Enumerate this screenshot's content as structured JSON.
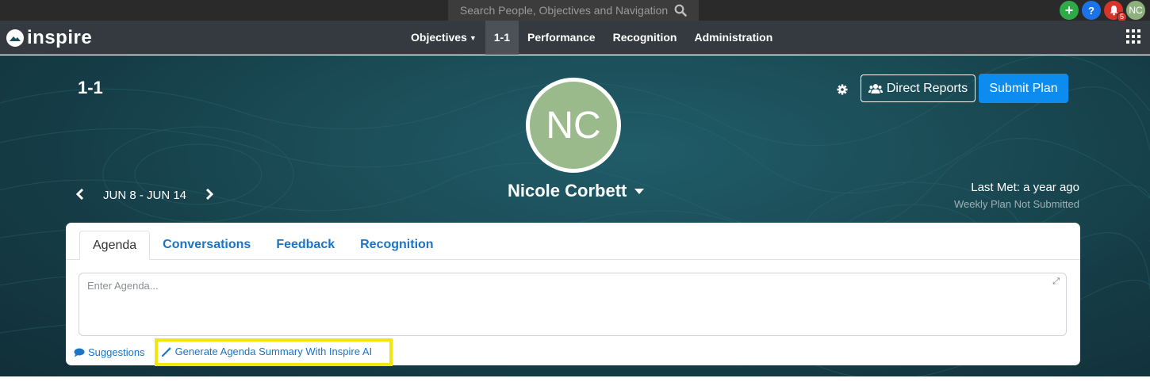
{
  "search": {
    "placeholder": "Search People, Objectives and Navigation"
  },
  "top_icons": {
    "notification_count": "5",
    "user_initials": "NC"
  },
  "brand": {
    "name": "inspire"
  },
  "nav": {
    "items": [
      {
        "label": "Objectives",
        "has_dropdown": true,
        "active": false
      },
      {
        "label": "1-1",
        "active": true
      },
      {
        "label": "Performance",
        "active": false
      },
      {
        "label": "Recognition",
        "active": false
      },
      {
        "label": "Administration",
        "active": false
      }
    ]
  },
  "page": {
    "title": "1-1",
    "date_range": "JUN 8 - JUN 14",
    "person_initials": "NC",
    "person_name": "Nicole Corbett",
    "direct_reports_label": "Direct Reports",
    "submit_label": "Submit Plan",
    "last_met": "Last Met: a year ago",
    "plan_status": "Weekly Plan Not Submitted"
  },
  "tabs": [
    {
      "label": "Agenda",
      "active": true
    },
    {
      "label": "Conversations",
      "active": false
    },
    {
      "label": "Feedback",
      "active": false
    },
    {
      "label": "Recognition",
      "active": false
    }
  ],
  "agenda": {
    "placeholder": "Enter Agenda...",
    "suggestions_label": "Suggestions",
    "ai_label": "Generate Agenda Summary With Inspire AI"
  },
  "colors": {
    "accent": "#0d8cf0",
    "link": "#1b74c5",
    "highlight": "#f2e60f",
    "hero_bg": "#1b4d57",
    "navbar_bg": "#343a40"
  }
}
